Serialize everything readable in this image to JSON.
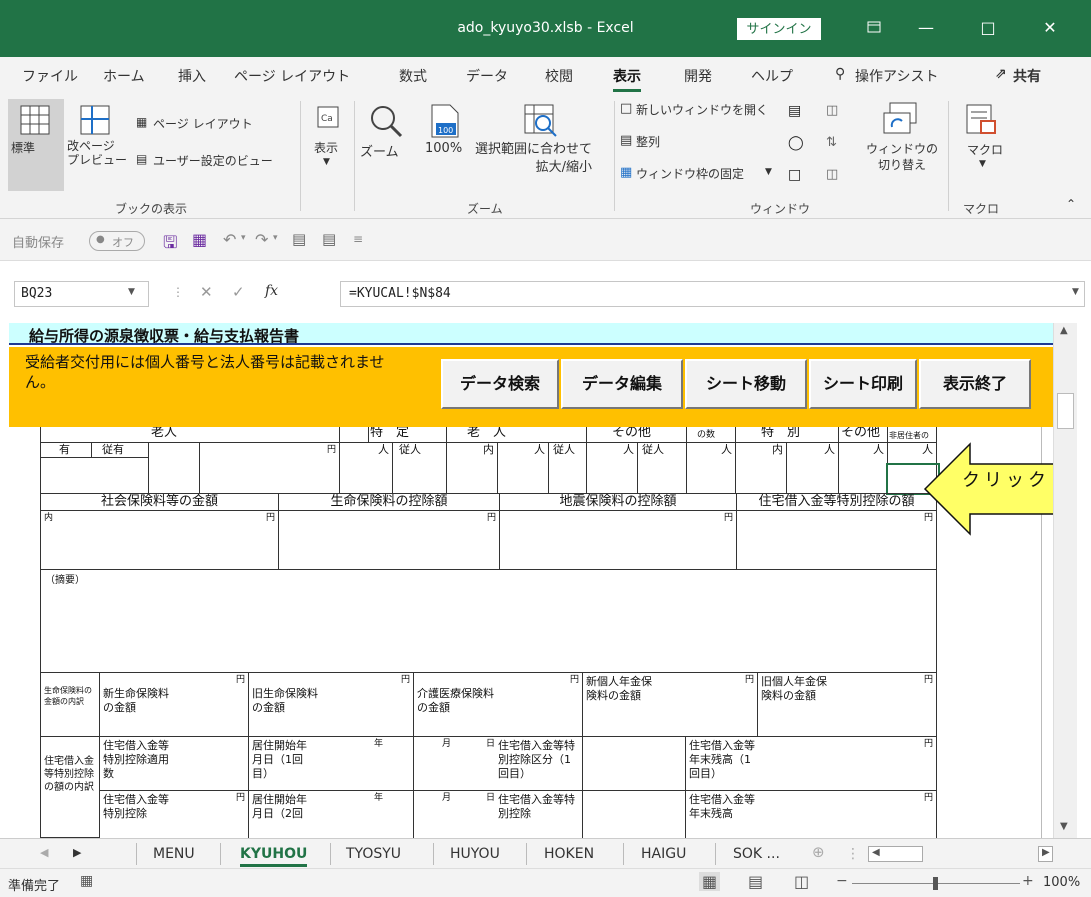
{
  "window": {
    "title": "ado_kyuyo30.xlsb  -  Excel",
    "signin": "サインイン"
  },
  "menu": {
    "tabs": [
      "ファイル",
      "ホーム",
      "挿入",
      "ページ レイアウト",
      "数式",
      "データ",
      "校閲",
      "表示",
      "開発",
      "ヘルプ",
      "操作アシスト"
    ],
    "active": "表示",
    "share": "共有"
  },
  "ribbon": {
    "view_group": {
      "normal": "標準",
      "pagebreak": "改ページ\nプレビュー",
      "pagelayout": "ページ レイアウト",
      "custom": "ユーザー設定のビュー",
      "label": "ブックの表示"
    },
    "show": "表示",
    "zoom_group": {
      "zoom": "ズーム",
      "hundred": "100%",
      "fit": "選択範囲に合わせて\n拡大/縮小",
      "label": "ズーム"
    },
    "window_group": {
      "new_window": "新しいウィンドウを開く",
      "arrange": "整列",
      "freeze": "ウィンドウ枠の固定",
      "switch": "ウィンドウの\n切り替え",
      "label": "ウィンドウ"
    },
    "macro_group": {
      "macro": "マクロ",
      "label": "マクロ"
    }
  },
  "qat": {
    "autosave": "自動保存",
    "autosave_state": "オフ"
  },
  "formula_bar": {
    "cell_ref": "BQ23",
    "fx": "fx",
    "formula": "=KYUCAL!$N$84"
  },
  "sheet": {
    "title": "給与所得の源泉徴収票・給与支払報告書",
    "notice": "受給者交付用には個人番号と法人番号は記載されません。",
    "buttons": [
      "データ検索",
      "データ編集",
      "シート移動",
      "シート印刷",
      "表示終了"
    ],
    "header1": {
      "roujin": "老人",
      "tokutei": "特　定",
      "rou": "老　人",
      "sonota": "その他",
      "ka": "の数",
      "tokubetsu": "特　別",
      "sonota2": "その他",
      "hikyo": "非居住者の数"
    },
    "header2": {
      "ari": "有",
      "juu": "従有",
      "en": "円",
      "nin": "人",
      "juunin": "従人",
      "uchi": "内"
    },
    "section2": [
      "社会保険料等の金額",
      "生命保険料の控除額",
      "地震保険料の控除額",
      "住宅借入金等特別控除の額"
    ],
    "yen": "円",
    "uchi": "内",
    "tekiyo": "（摘要）",
    "insurance_row": {
      "label": "生命保険料の金額の内訳",
      "items": [
        "新生命保険料の金額",
        "旧生命保険料の金額",
        "介護医療保険料の金額",
        "新個人年金保険料の金額",
        "旧個人年金保険料の金額"
      ]
    },
    "housing_rows": {
      "label": "住宅借入金等特別控除の額の内訳",
      "row1": [
        "住宅借入金等特別控除適用数",
        "居住開始年月日（1回目）",
        "住宅借入金等特別控除区分（1回目）",
        "住宅借入金等年末残高（1回目）"
      ],
      "row2": [
        "住宅借入金等特別控除",
        "居住開始年月日（2回",
        "住宅借入金等特別控除",
        "住宅借入金等年末残高"
      ],
      "nen": "年",
      "gatsu": "月",
      "nichi": "日"
    }
  },
  "callout": {
    "text": "クリック"
  },
  "sheet_tabs": {
    "tabs": [
      "MENU",
      "KYUHOU",
      "TYOSYU",
      "HUYOU",
      "HOKEN",
      "HAIGU",
      "SOK ..."
    ],
    "active": "KYUHOU"
  },
  "status": {
    "ready": "準備完了",
    "zoom": "100%"
  },
  "colors": {
    "excel_green": "#217346",
    "title_band": "#ccffff",
    "notice_band": "#ffc000",
    "callout_fill": "#ffff66"
  }
}
